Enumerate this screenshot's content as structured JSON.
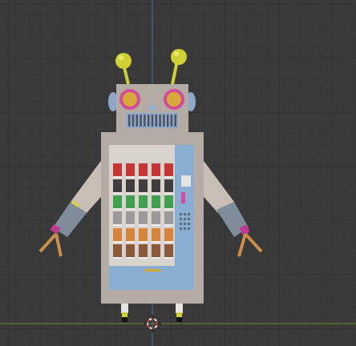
{
  "viewport": {
    "background": "#3a3a3a",
    "grid_minor": "#333333",
    "grid_major": "#2b2b2b",
    "axis_y_color": "#3f6fb0",
    "axis_x_color": "#6f8b2e"
  },
  "model": {
    "head_color": "#b4aba5",
    "body_color": "#b4aba5",
    "panel_color": "#89aed1",
    "glass_color": "#d8d3cd",
    "antenna_color": "#cfd033",
    "eye_ring_color": "#d24c9a",
    "eye_color": "#d7a83a",
    "arm_color": "#c8beb6",
    "forearm_color": "#7f8c99",
    "hand_color": "#c98d4c",
    "wrist_color": "#c0388f",
    "product_rows": [
      [
        "#c73535",
        "#c73535",
        "#c73535",
        "#c73535",
        "#c73535"
      ],
      [
        "#3e3e3e",
        "#3e3e3e",
        "#3e3e3e",
        "#3e3e3e",
        "#3e3e3e"
      ],
      [
        "#3fa050",
        "#3fa050",
        "#3fa050",
        "#3fa050",
        "#3fa050"
      ],
      [
        "#9a9a9a",
        "#9a9a9a",
        "#9a9a9a",
        "#9a9a9a",
        "#9a9a9a"
      ],
      [
        "#d6843c",
        "#d6843c",
        "#d6843c",
        "#d6843c",
        "#d6843c"
      ],
      [
        "#8a5a3a",
        "#8a5a3a",
        "#8a5a3a",
        "#8a5a3a",
        "#8a5a3a"
      ]
    ]
  }
}
